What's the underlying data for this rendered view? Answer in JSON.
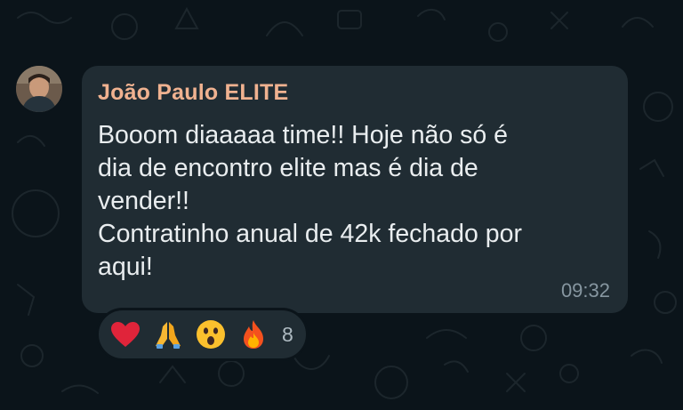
{
  "chat": {
    "background_color": "#0b141a",
    "bubble_color": "#202c33"
  },
  "message": {
    "sender": "João Paulo ELITE",
    "sender_color": "#f0b290",
    "text": "Booom diaaaaa time!! Hoje não só é\ndia de encontro elite mas é dia de\nvender!!\nContratinho anual de 42k fechado por\naqui!",
    "time": "09:32"
  },
  "reactions": {
    "emojis": [
      "red-heart-icon",
      "folded-hands-icon",
      "surprised-face-icon",
      "fire-icon"
    ],
    "count": "8"
  }
}
